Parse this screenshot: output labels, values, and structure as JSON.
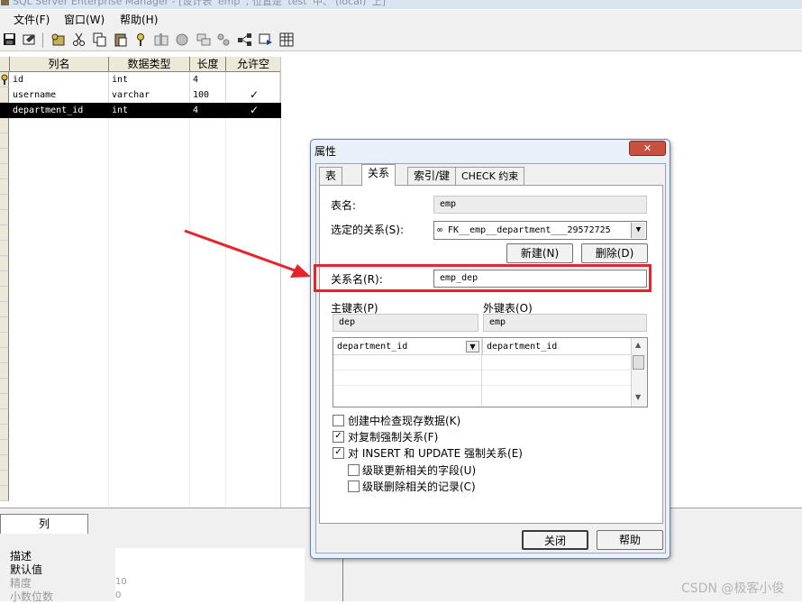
{
  "window": {
    "title": "SQL Server Enterprise Manager - [设计表 'emp' , 位置是 'test' 中、'(local)' 上]"
  },
  "menu": {
    "items": [
      {
        "label": "文件(F)"
      },
      {
        "label": "窗口(W)"
      },
      {
        "label": "帮助(H)"
      }
    ]
  },
  "grid": {
    "columns": [
      "列名",
      "数据类型",
      "长度",
      "允许空"
    ],
    "rows": [
      {
        "name": "id",
        "type": "int",
        "length": "4",
        "nullable": "",
        "primary_key": true,
        "selected": false
      },
      {
        "name": "username",
        "type": "varchar",
        "length": "100",
        "nullable": "✓",
        "primary_key": false,
        "selected": false
      },
      {
        "name": "department_id",
        "type": "int",
        "length": "4",
        "nullable": "✓",
        "primary_key": false,
        "selected": true
      }
    ]
  },
  "bottom_panel": {
    "tab_label": "列",
    "properties": [
      {
        "label": "描述",
        "value": ""
      },
      {
        "label": "默认值",
        "value": ""
      },
      {
        "label": "精度",
        "value": "10"
      },
      {
        "label": "小数位数",
        "value": "0"
      }
    ]
  },
  "dialog": {
    "title": "属性",
    "close_symbol": "✕",
    "tabs": [
      {
        "label": "表",
        "active": false
      },
      {
        "label": "关系",
        "active": true
      },
      {
        "label": "索引/键",
        "active": false
      },
      {
        "label": "CHECK 约束",
        "active": false
      }
    ],
    "table_name": {
      "label": "表名:",
      "value": "emp"
    },
    "selected_relation": {
      "label": "选定的关系(S):",
      "value": "∞ FK__emp__department___29572725"
    },
    "new_button": "新建(N)",
    "delete_button": "删除(D)",
    "relation_name": {
      "label": "关系名(R):",
      "value": "emp_dep"
    },
    "primary_table": {
      "label": "主键表(P)",
      "value": "dep"
    },
    "foreign_table": {
      "label": "外键表(O)",
      "value": "emp"
    },
    "key_mapping": {
      "primary_column": "department_id",
      "foreign_column": "department_id"
    },
    "checkboxes": [
      {
        "label": "创建中检查现存数据(K)",
        "checked": false
      },
      {
        "label": "对复制强制关系(F)",
        "checked": true
      },
      {
        "label": "对 INSERT 和 UPDATE 强制关系(E)",
        "checked": true
      },
      {
        "label": "级联更新相关的字段(U)",
        "checked": false
      },
      {
        "label": "级联删除相关的记录(C)",
        "checked": false
      }
    ],
    "close_button": "关闭",
    "help_button": "帮助"
  },
  "annotation": {
    "color": "#e8232a"
  },
  "watermark": "CSDN @极客小俊"
}
